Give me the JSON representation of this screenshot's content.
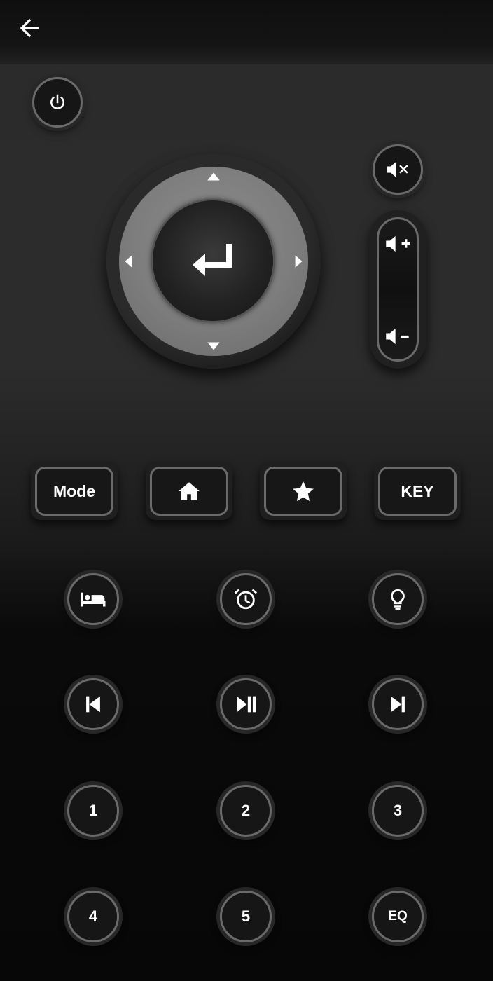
{
  "header": {
    "back_icon": "arrow-left-icon"
  },
  "power": {
    "icon": "power-icon"
  },
  "dpad": {
    "up_icon": "caret-up-icon",
    "down_icon": "caret-down-icon",
    "left_icon": "caret-left-icon",
    "right_icon": "caret-right-icon",
    "ok_icon": "enter-return-icon"
  },
  "volume": {
    "mute_icon": "volume-mute-icon",
    "up_icon": "volume-up-icon",
    "down_icon": "volume-down-icon"
  },
  "function_row": [
    {
      "label": "Mode"
    },
    {
      "icon": "home-icon"
    },
    {
      "icon": "star-icon"
    },
    {
      "label": "KEY"
    }
  ],
  "feature_row": [
    {
      "icon": "bed-icon"
    },
    {
      "icon": "alarm-clock-icon"
    },
    {
      "icon": "light-bulb-icon"
    }
  ],
  "media_row": [
    {
      "icon": "skip-previous-icon"
    },
    {
      "icon": "play-pause-icon"
    },
    {
      "icon": "skip-next-icon"
    }
  ],
  "keypad": {
    "row1": [
      "1",
      "2",
      "3"
    ],
    "row2": [
      "4",
      "5",
      "EQ"
    ]
  },
  "colors": {
    "background": "#2b2b2b",
    "button_border": "#6a6a6a",
    "dpad_ring": "#808080",
    "text": "#ffffff"
  }
}
